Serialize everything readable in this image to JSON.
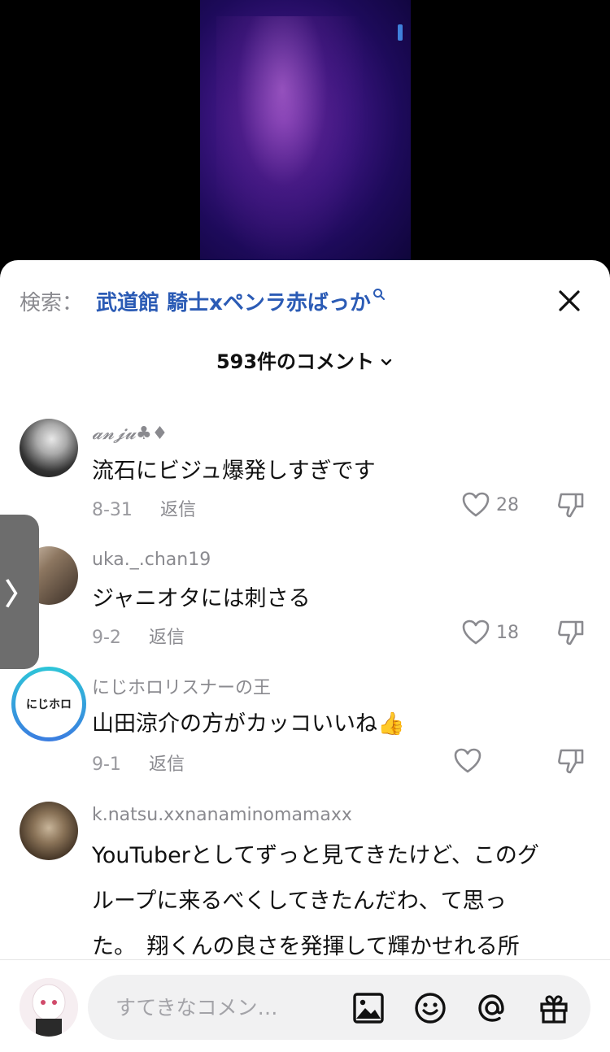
{
  "search": {
    "label": "検索：",
    "query": "武道館 騎士xペンラ赤ばっか"
  },
  "comments_header": {
    "count_label": "593件のコメント"
  },
  "comments": [
    {
      "username": "𝓪𝓷𝓳𝓾♣♦",
      "text": "流石にビジュ爆発しすぎです",
      "date": "8-31",
      "reply": "返信",
      "likes": "28"
    },
    {
      "username": "uka._.chan19",
      "text": "ジャニオタには刺さる",
      "date": "9-2",
      "reply": "返信",
      "likes": "18"
    },
    {
      "username": "にじホロリスナーの王",
      "text": "山田涼介の方がカッコいいね👍",
      "date": "9-1",
      "reply": "返信",
      "likes": "",
      "avatar_text": "にじホロ"
    },
    {
      "username": "k.natsu.xxnanaminomamaxx",
      "text_lines": [
        "YouTuberとしてずっと見てきたけど、このグ",
        "ループに来るべくしてきたんだわ、て思っ",
        "た。　翔くんの良さを発揮して輝かせれる所"
      ]
    }
  ],
  "side_handle": {
    "glyph": "〉"
  },
  "composer": {
    "placeholder": "すてきなコメン…"
  },
  "icons": [
    "search-icon",
    "close-icon",
    "chevron-down-icon",
    "heart-icon",
    "thumbs-down-icon",
    "image-icon",
    "emoji-icon",
    "mention-icon",
    "gift-icon"
  ],
  "colors": {
    "accent_link": "#2b5bb5",
    "muted": "#8a8a8f",
    "ring_gradient": [
      "#2ec5d8",
      "#3b7de0"
    ]
  }
}
